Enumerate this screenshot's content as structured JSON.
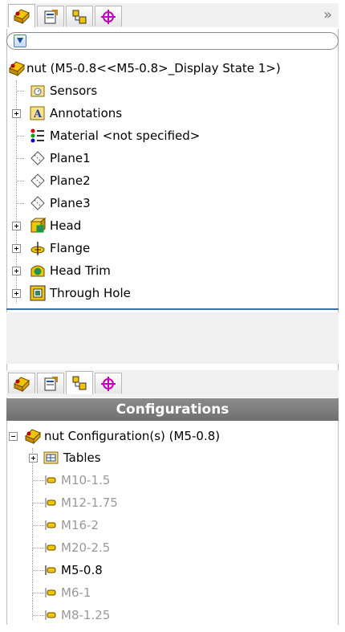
{
  "top_panel": {
    "overflow_glyph": "»",
    "tabs": [
      "feature-manager-tab",
      "property-manager-tab",
      "configuration-manager-tab",
      "dimxpert-manager-tab"
    ],
    "tree": {
      "root": "nut  (M5-0.8<<M5-0.8>_Display State 1>)",
      "items": [
        {
          "label": "Sensors",
          "icon": "sensors-icon",
          "expandable": false
        },
        {
          "label": "Annotations",
          "icon": "annotations-icon",
          "expandable": true
        },
        {
          "label": "Material <not specified>",
          "icon": "material-icon",
          "expandable": false
        },
        {
          "label": "Plane1",
          "icon": "plane-icon",
          "expandable": false
        },
        {
          "label": "Plane2",
          "icon": "plane-icon",
          "expandable": false
        },
        {
          "label": "Plane3",
          "icon": "plane-icon",
          "expandable": false
        },
        {
          "label": "Head",
          "icon": "extrude-icon",
          "expandable": true
        },
        {
          "label": "Flange",
          "icon": "revolve-icon",
          "expandable": true
        },
        {
          "label": "Head Trim",
          "icon": "cut-icon",
          "expandable": true
        },
        {
          "label": "Through Hole",
          "icon": "hole-icon",
          "expandable": true
        }
      ]
    }
  },
  "bottom_panel": {
    "header": "Configurations",
    "tabs": [
      "feature-manager-tab",
      "property-manager-tab",
      "configuration-manager-tab",
      "dimxpert-manager-tab"
    ],
    "root": "nut Configuration(s)  (M5-0.8)",
    "tables_label": "Tables",
    "configs": [
      {
        "label": "M10-1.5",
        "active": false
      },
      {
        "label": "M12-1.75",
        "active": false
      },
      {
        "label": "M16-2",
        "active": false
      },
      {
        "label": "M20-2.5",
        "active": false
      },
      {
        "label": "M5-0.8",
        "active": true
      },
      {
        "label": "M6-1",
        "active": false
      },
      {
        "label": "M8-1.25",
        "active": false
      }
    ]
  },
  "colors": {
    "accent": "#3a6ea5",
    "header_bg": "#7d7d7d",
    "inactive_text": "#999999"
  }
}
